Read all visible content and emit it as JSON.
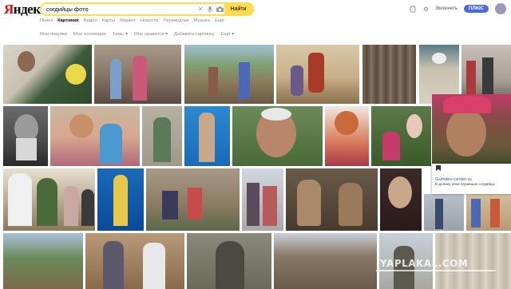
{
  "header": {
    "logo_first": "Я",
    "logo_rest": "ндекс",
    "search_value": "согдийцы фото",
    "find_label": "Найти",
    "enable_label": "Включить",
    "plus_label": "ПЛЮС"
  },
  "services": [
    "Поиск",
    "Картинки",
    "Видео",
    "Карты",
    "Маркет",
    "Новости",
    "Переводчик",
    "Музыка",
    "Ещё"
  ],
  "filters": [
    "Мои покупки",
    "Мои коллекции",
    "Темы ▾",
    "Мне нравится ▾",
    "Добавить картинку",
    "Ещё ▾"
  ],
  "popup": {
    "site": "Gumilev-center.ru",
    "description": "В долину реки Зеравшан согдийцы"
  },
  "watermark": "YAPLAKAL.COM",
  "colors": {
    "search_border": "#ffdb4d",
    "plus_button": "#4a6ae0",
    "logo_red": "#ff0000"
  },
  "icons": [
    "clear-icon",
    "microphone-icon",
    "camera-icon",
    "bell-icon",
    "settings-icon"
  ]
}
